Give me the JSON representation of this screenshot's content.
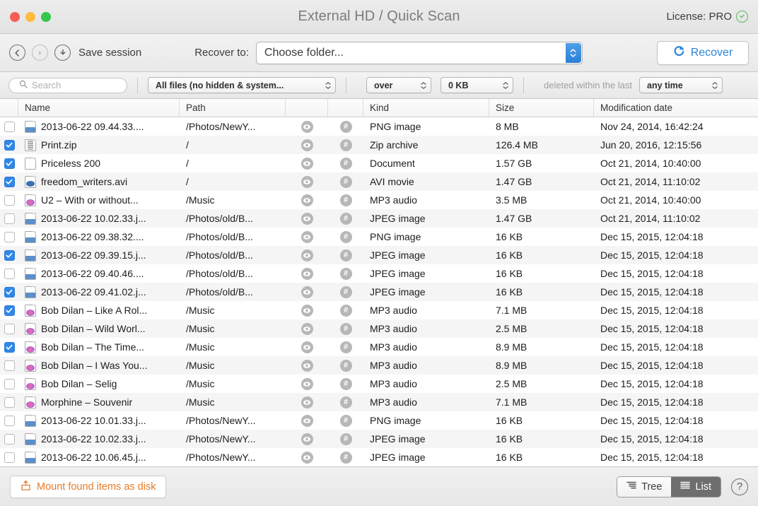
{
  "window": {
    "title": "External HD / Quick Scan",
    "traffic_lights": [
      "close-button",
      "minimize-button",
      "maximize-button"
    ],
    "license_label": "License: PRO"
  },
  "toolbar": {
    "back_icon": "chevron-left-circle-icon",
    "forward_icon": "play-circle-icon",
    "save_icon": "download-circle-icon",
    "save_session_label": "Save session",
    "recover_to_label": "Recover to:",
    "folder_value": "Choose folder...",
    "recover_label": "Recover",
    "recover_color": "#2b84d8"
  },
  "filterbar": {
    "search_placeholder": "Search",
    "search_value": "",
    "files_filter": "All files (no hidden & system...",
    "comparator": "over",
    "size_threshold": "0 KB",
    "deleted_label": "deleted within the last",
    "time_filter": "any time"
  },
  "table": {
    "columns": [
      "Name",
      "Path",
      "",
      "",
      "Kind",
      "Size",
      "Modification date"
    ],
    "headers": {
      "name": "Name",
      "path": "Path",
      "kind": "Kind",
      "size": "Size",
      "date": "Modification date"
    },
    "rows": [
      {
        "checked": false,
        "icon": "image-file-icon",
        "name": "2013-06-22 09.44.33....",
        "path": "/Photos/NewY...",
        "kind": "PNG image",
        "size": "8 MB",
        "date": "Nov 24, 2014, 16:42:24"
      },
      {
        "checked": true,
        "icon": "zip-file-icon",
        "name": "Print.zip",
        "path": "/",
        "kind": "Zip archive",
        "size": "126.4 MB",
        "date": "Jun 20, 2016, 12:15:56"
      },
      {
        "checked": true,
        "icon": "document-file-icon",
        "name": "Priceless 200",
        "path": "/",
        "kind": "Document",
        "size": "1.57 GB",
        "date": "Oct 21, 2014, 10:40:00"
      },
      {
        "checked": true,
        "icon": "movie-file-icon",
        "name": "freedom_writers.avi",
        "path": "/",
        "kind": "AVI movie",
        "size": "1.47 GB",
        "date": "Oct 21, 2014, 11:10:02"
      },
      {
        "checked": false,
        "icon": "music-file-icon",
        "name": "U2 – With or without...",
        "path": "/Music",
        "kind": "MP3 audio",
        "size": "3.5 MB",
        "date": "Oct 21, 2014, 10:40:00"
      },
      {
        "checked": false,
        "icon": "image-file-icon",
        "name": "2013-06-22 10.02.33.j...",
        "path": "/Photos/old/B...",
        "kind": "JPEG image",
        "size": "1.47 GB",
        "date": "Oct 21, 2014, 11:10:02"
      },
      {
        "checked": false,
        "icon": "image-file-icon",
        "name": "2013-06-22 09.38.32....",
        "path": "/Photos/old/B...",
        "kind": "PNG image",
        "size": "16 KB",
        "date": "Dec 15, 2015, 12:04:18"
      },
      {
        "checked": true,
        "icon": "image-file-icon",
        "name": "2013-06-22 09.39.15.j...",
        "path": "/Photos/old/B...",
        "kind": "JPEG image",
        "size": "16 KB",
        "date": "Dec 15, 2015, 12:04:18"
      },
      {
        "checked": false,
        "icon": "image-file-icon",
        "name": "2013-06-22 09.40.46....",
        "path": "/Photos/old/B...",
        "kind": "JPEG image",
        "size": "16 KB",
        "date": "Dec 15, 2015, 12:04:18"
      },
      {
        "checked": true,
        "icon": "image-file-icon",
        "name": "2013-06-22 09.41.02.j...",
        "path": "/Photos/old/B...",
        "kind": "JPEG image",
        "size": "16 KB",
        "date": "Dec 15, 2015, 12:04:18"
      },
      {
        "checked": true,
        "icon": "music-file-icon",
        "name": "Bob Dilan – Like A Rol...",
        "path": "/Music",
        "kind": "MP3 audio",
        "size": "7.1 MB",
        "date": "Dec 15, 2015, 12:04:18"
      },
      {
        "checked": false,
        "icon": "music-file-icon",
        "name": "Bob Dilan – Wild Worl...",
        "path": "/Music",
        "kind": "MP3 audio",
        "size": "2.5 MB",
        "date": "Dec 15, 2015, 12:04:18"
      },
      {
        "checked": true,
        "icon": "music-file-icon",
        "name": "Bob Dilan – The Time...",
        "path": "/Music",
        "kind": "MP3 audio",
        "size": "8.9 MB",
        "date": "Dec 15, 2015, 12:04:18"
      },
      {
        "checked": false,
        "icon": "music-file-icon",
        "name": "Bob Dilan – I Was You...",
        "path": "/Music",
        "kind": "MP3 audio",
        "size": "8.9 MB",
        "date": "Dec 15, 2015, 12:04:18"
      },
      {
        "checked": false,
        "icon": "music-file-icon",
        "name": "Bob Dilan – Selig",
        "path": "/Music",
        "kind": "MP3 audio",
        "size": "2.5 MB",
        "date": "Dec 15, 2015, 12:04:18"
      },
      {
        "checked": false,
        "icon": "music-file-icon",
        "name": "Morphine – Souvenir",
        "path": "/Music",
        "kind": "MP3 audio",
        "size": "7.1 MB",
        "date": "Dec 15, 2015, 12:04:18"
      },
      {
        "checked": false,
        "icon": "image-file-icon",
        "name": "2013-06-22 10.01.33.j...",
        "path": "/Photos/NewY...",
        "kind": "PNG image",
        "size": "16 KB",
        "date": "Dec 15, 2015, 12:04:18"
      },
      {
        "checked": false,
        "icon": "image-file-icon",
        "name": "2013-06-22 10.02.33.j...",
        "path": "/Photos/NewY...",
        "kind": "JPEG image",
        "size": "16 KB",
        "date": "Dec 15, 2015, 12:04:18"
      },
      {
        "checked": false,
        "icon": "image-file-icon",
        "name": "2013-06-22 10.06.45.j...",
        "path": "/Photos/NewY...",
        "kind": "JPEG image",
        "size": "16 KB",
        "date": "Dec 15, 2015, 12:04:18"
      },
      {
        "checked": false,
        "icon": "",
        "name": "",
        "path": "",
        "kind": "",
        "size": "",
        "date": ""
      }
    ],
    "row_action_icons": {
      "preview": "eye-icon",
      "hex": "hash-icon"
    }
  },
  "bottombar": {
    "mount_label": "Mount found items as disk",
    "mount_color": "#e57b2a",
    "tree_label": "Tree",
    "list_label": "List",
    "active_view": "List",
    "help_label": "?"
  }
}
